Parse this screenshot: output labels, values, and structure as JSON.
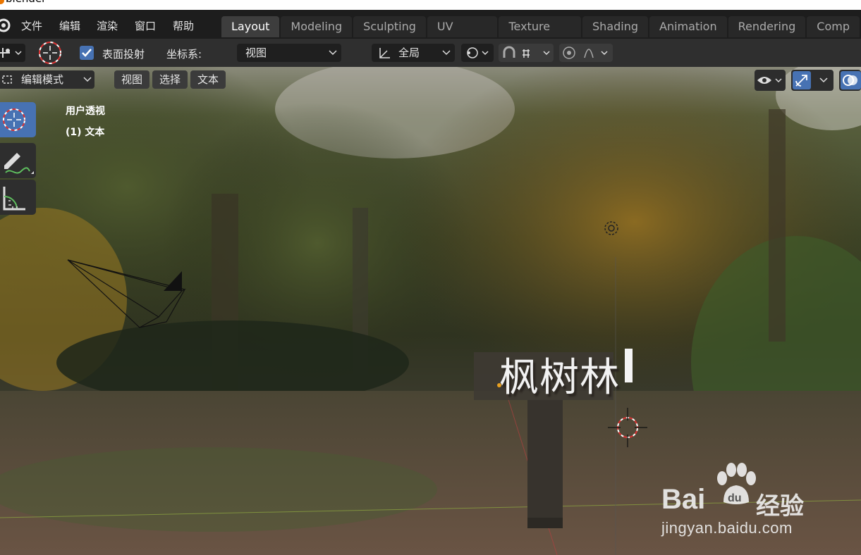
{
  "window": {
    "title": "blender"
  },
  "menubar": {
    "menus": [
      "文件",
      "编辑",
      "渲染",
      "窗口",
      "帮助"
    ],
    "workspace_tabs": [
      "Layout",
      "Modeling",
      "Sculpting",
      "UV Editing",
      "Texture Paint",
      "Shading",
      "Animation",
      "Rendering",
      "Comp"
    ],
    "active_tab": "Layout"
  },
  "toolbar": {
    "surface_project_label": "表面投射",
    "surface_project_checked": true,
    "coord_system_label": "坐标系:",
    "coord_system_value": "视图",
    "transform_orientation_value": "全局"
  },
  "viewport_header": {
    "mode": "编辑模式",
    "menus": [
      "视图",
      "选择",
      "文本"
    ]
  },
  "viewport": {
    "view_name": "用户透视",
    "object_info": "(1) 文本",
    "scene_text": "枫树林"
  },
  "watermark": {
    "brand": "Bai",
    "brand_suffix": "经验",
    "url": "jingyan.baidu.com"
  },
  "colors": {
    "accent_blue": "#4772b3",
    "active_tab_bg": "#3d3d3d",
    "menubar_bg": "#1d1d1d",
    "sign_color": "#3a3630"
  }
}
